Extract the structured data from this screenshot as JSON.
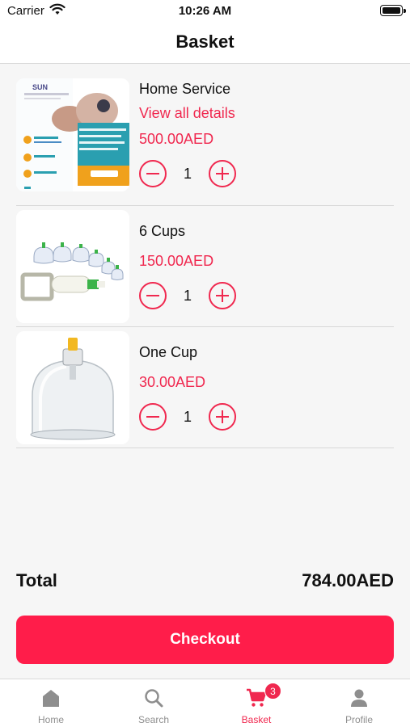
{
  "status_bar": {
    "carrier": "Carrier",
    "time": "10:26 AM"
  },
  "header": {
    "title": "Basket"
  },
  "items": [
    {
      "name": "Home Service",
      "link": "View all details",
      "price": "500.00AED",
      "quantity": "1",
      "image_icon": "service-flyer-image"
    },
    {
      "name": "6 Cups",
      "link": "",
      "price": "150.00AED",
      "quantity": "1",
      "image_icon": "cupping-set-image"
    },
    {
      "name": "One Cup",
      "link": "",
      "price": "30.00AED",
      "quantity": "1",
      "image_icon": "single-cup-image"
    }
  ],
  "summary": {
    "total_label": "Total",
    "total_value": "784.00AED"
  },
  "checkout": {
    "label": "Checkout"
  },
  "tabs": [
    {
      "label": "Home",
      "icon": "home-icon"
    },
    {
      "label": "Search",
      "icon": "search-icon"
    },
    {
      "label": "Basket",
      "icon": "cart-icon",
      "badge": "3",
      "active": true
    },
    {
      "label": "Profile",
      "icon": "profile-icon"
    }
  ],
  "colors": {
    "accent": "#f0284f",
    "checkout_bg": "#ff1d4a",
    "tab_inactive": "#8e8e8e"
  }
}
